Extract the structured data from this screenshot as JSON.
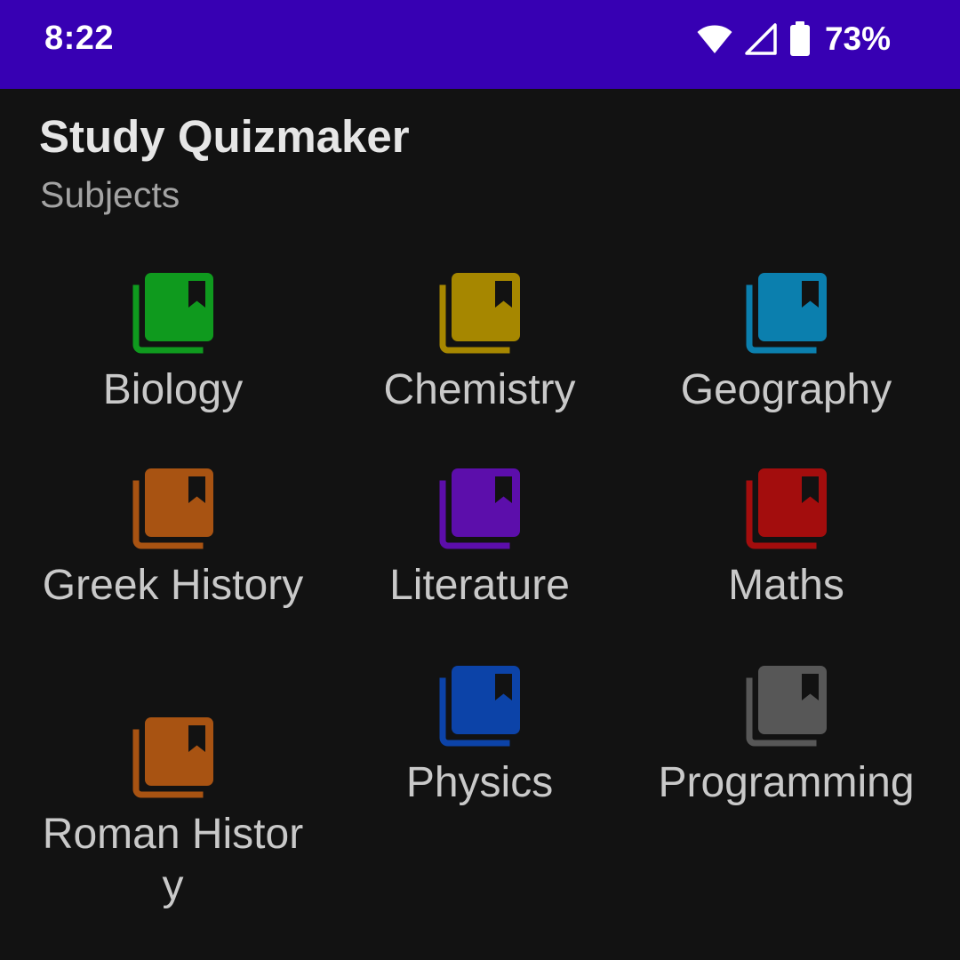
{
  "status_bar": {
    "time": "8:22",
    "battery_percent": "73%",
    "wifi_icon": "wifi-icon",
    "signal_icon": "cell-signal-icon",
    "battery_icon": "battery-icon",
    "background": "#3700b3"
  },
  "app": {
    "title": "Study Quizmaker",
    "subtitle": "Subjects"
  },
  "subjects": [
    {
      "label": "Biology",
      "color": "#0f9a1e",
      "icon": "library-books-icon"
    },
    {
      "label": "Chemistry",
      "color": "#a68700",
      "icon": "library-books-icon"
    },
    {
      "label": "Geography",
      "color": "#0b7fae",
      "icon": "library-books-icon"
    },
    {
      "label": "Greek History",
      "color": "#a85312",
      "icon": "library-books-icon"
    },
    {
      "label": "Literature",
      "color": "#5c0eab",
      "icon": "library-books-icon"
    },
    {
      "label": "Maths",
      "color": "#a30d0d",
      "icon": "library-books-icon"
    },
    {
      "label": "Roman History",
      "color": "#a85312",
      "icon": "library-books-icon"
    },
    {
      "label": "Physics",
      "color": "#0c43a8",
      "icon": "library-books-icon"
    },
    {
      "label": "Programming",
      "color": "#575757",
      "icon": "library-books-icon"
    }
  ]
}
